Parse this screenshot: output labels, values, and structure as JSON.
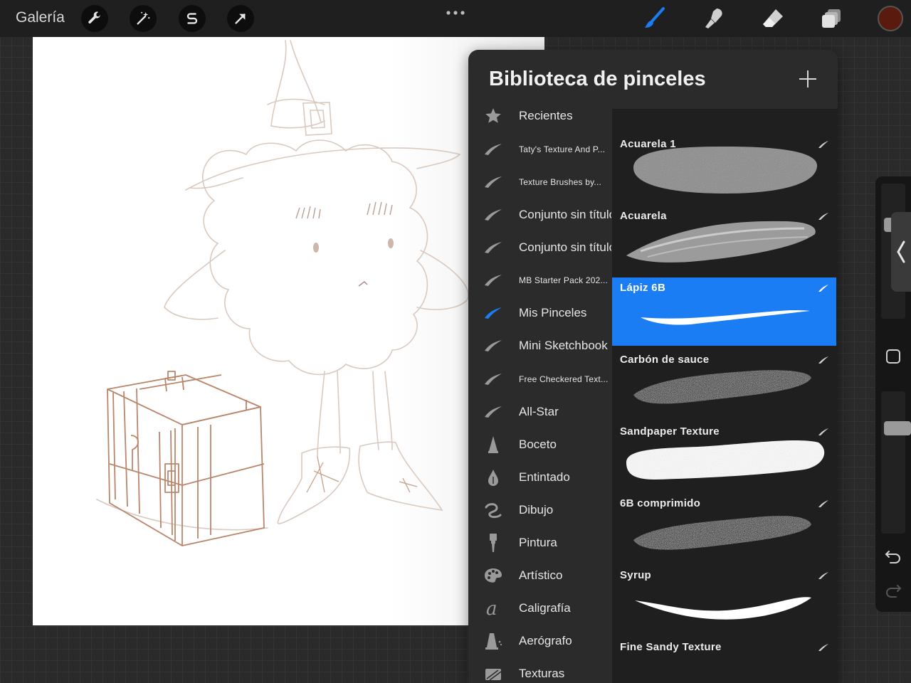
{
  "topbar": {
    "gallery_label": "Galería",
    "tools": [
      {
        "name": "wrench-icon"
      },
      {
        "name": "magic-wand-icon"
      },
      {
        "name": "selection-s-icon"
      },
      {
        "name": "transform-arrow-icon"
      }
    ],
    "right_tools": [
      "brush-icon",
      "smudge-icon",
      "eraser-icon",
      "layers-icon"
    ],
    "active_tool": "brush-icon",
    "accent_color": "#1a7df3",
    "current_color": "#5a1a0e"
  },
  "panel": {
    "title": "Biblioteca de pinceles",
    "sets": [
      {
        "label": "Recientes",
        "icon": "star-icon",
        "size": "big"
      },
      {
        "label": "Taty's Texture And P...",
        "icon": "brush-stroke-icon",
        "size": "small"
      },
      {
        "label": "Texture Brushes by...",
        "icon": "brush-stroke-icon",
        "size": "small"
      },
      {
        "label": "Conjunto sin título",
        "icon": "brush-stroke-icon",
        "size": "big"
      },
      {
        "label": "Conjunto sin título",
        "icon": "brush-stroke-icon",
        "size": "big"
      },
      {
        "label": "MB Starter Pack 202...",
        "icon": "brush-stroke-icon",
        "size": "small"
      },
      {
        "label": "Mis Pinceles",
        "icon": "brush-stroke-icon",
        "size": "big",
        "selected": true
      },
      {
        "label": "Mini Sketchbook",
        "icon": "brush-stroke-icon",
        "size": "big"
      },
      {
        "label": "Free Checkered Text...",
        "icon": "brush-stroke-icon",
        "size": "small"
      },
      {
        "label": "All-Star",
        "icon": "brush-stroke-icon",
        "size": "big"
      },
      {
        "label": "Boceto",
        "icon": "pencil-tip-icon",
        "size": "big"
      },
      {
        "label": "Entintado",
        "icon": "ink-drop-icon",
        "size": "big"
      },
      {
        "label": "Dibujo",
        "icon": "loop-icon",
        "size": "big"
      },
      {
        "label": "Pintura",
        "icon": "paintbrush-icon",
        "size": "big"
      },
      {
        "label": "Artístico",
        "icon": "palette-icon",
        "size": "big"
      },
      {
        "label": "Caligrafía",
        "icon": "script-a-icon",
        "size": "big"
      },
      {
        "label": "Aerógrafo",
        "icon": "airbrush-icon",
        "size": "big"
      },
      {
        "label": "Texturas",
        "icon": "texture-icon",
        "size": "big"
      }
    ],
    "brushes": [
      {
        "label": "",
        "style": "texture-top"
      },
      {
        "label": "Acuarela 1",
        "style": "watercolor-blob"
      },
      {
        "label": "Acuarela",
        "style": "watercolor-streak"
      },
      {
        "label": "Lápiz 6B",
        "style": "pencil-line",
        "selected": true
      },
      {
        "label": "Carbón de sauce",
        "style": "charcoal"
      },
      {
        "label": "Sandpaper Texture",
        "style": "sandpaper"
      },
      {
        "label": "6B comprimido",
        "style": "compressed"
      },
      {
        "label": "Syrup",
        "style": "syrup"
      },
      {
        "label": "Fine Sandy Texture",
        "style": "sandy"
      }
    ]
  }
}
